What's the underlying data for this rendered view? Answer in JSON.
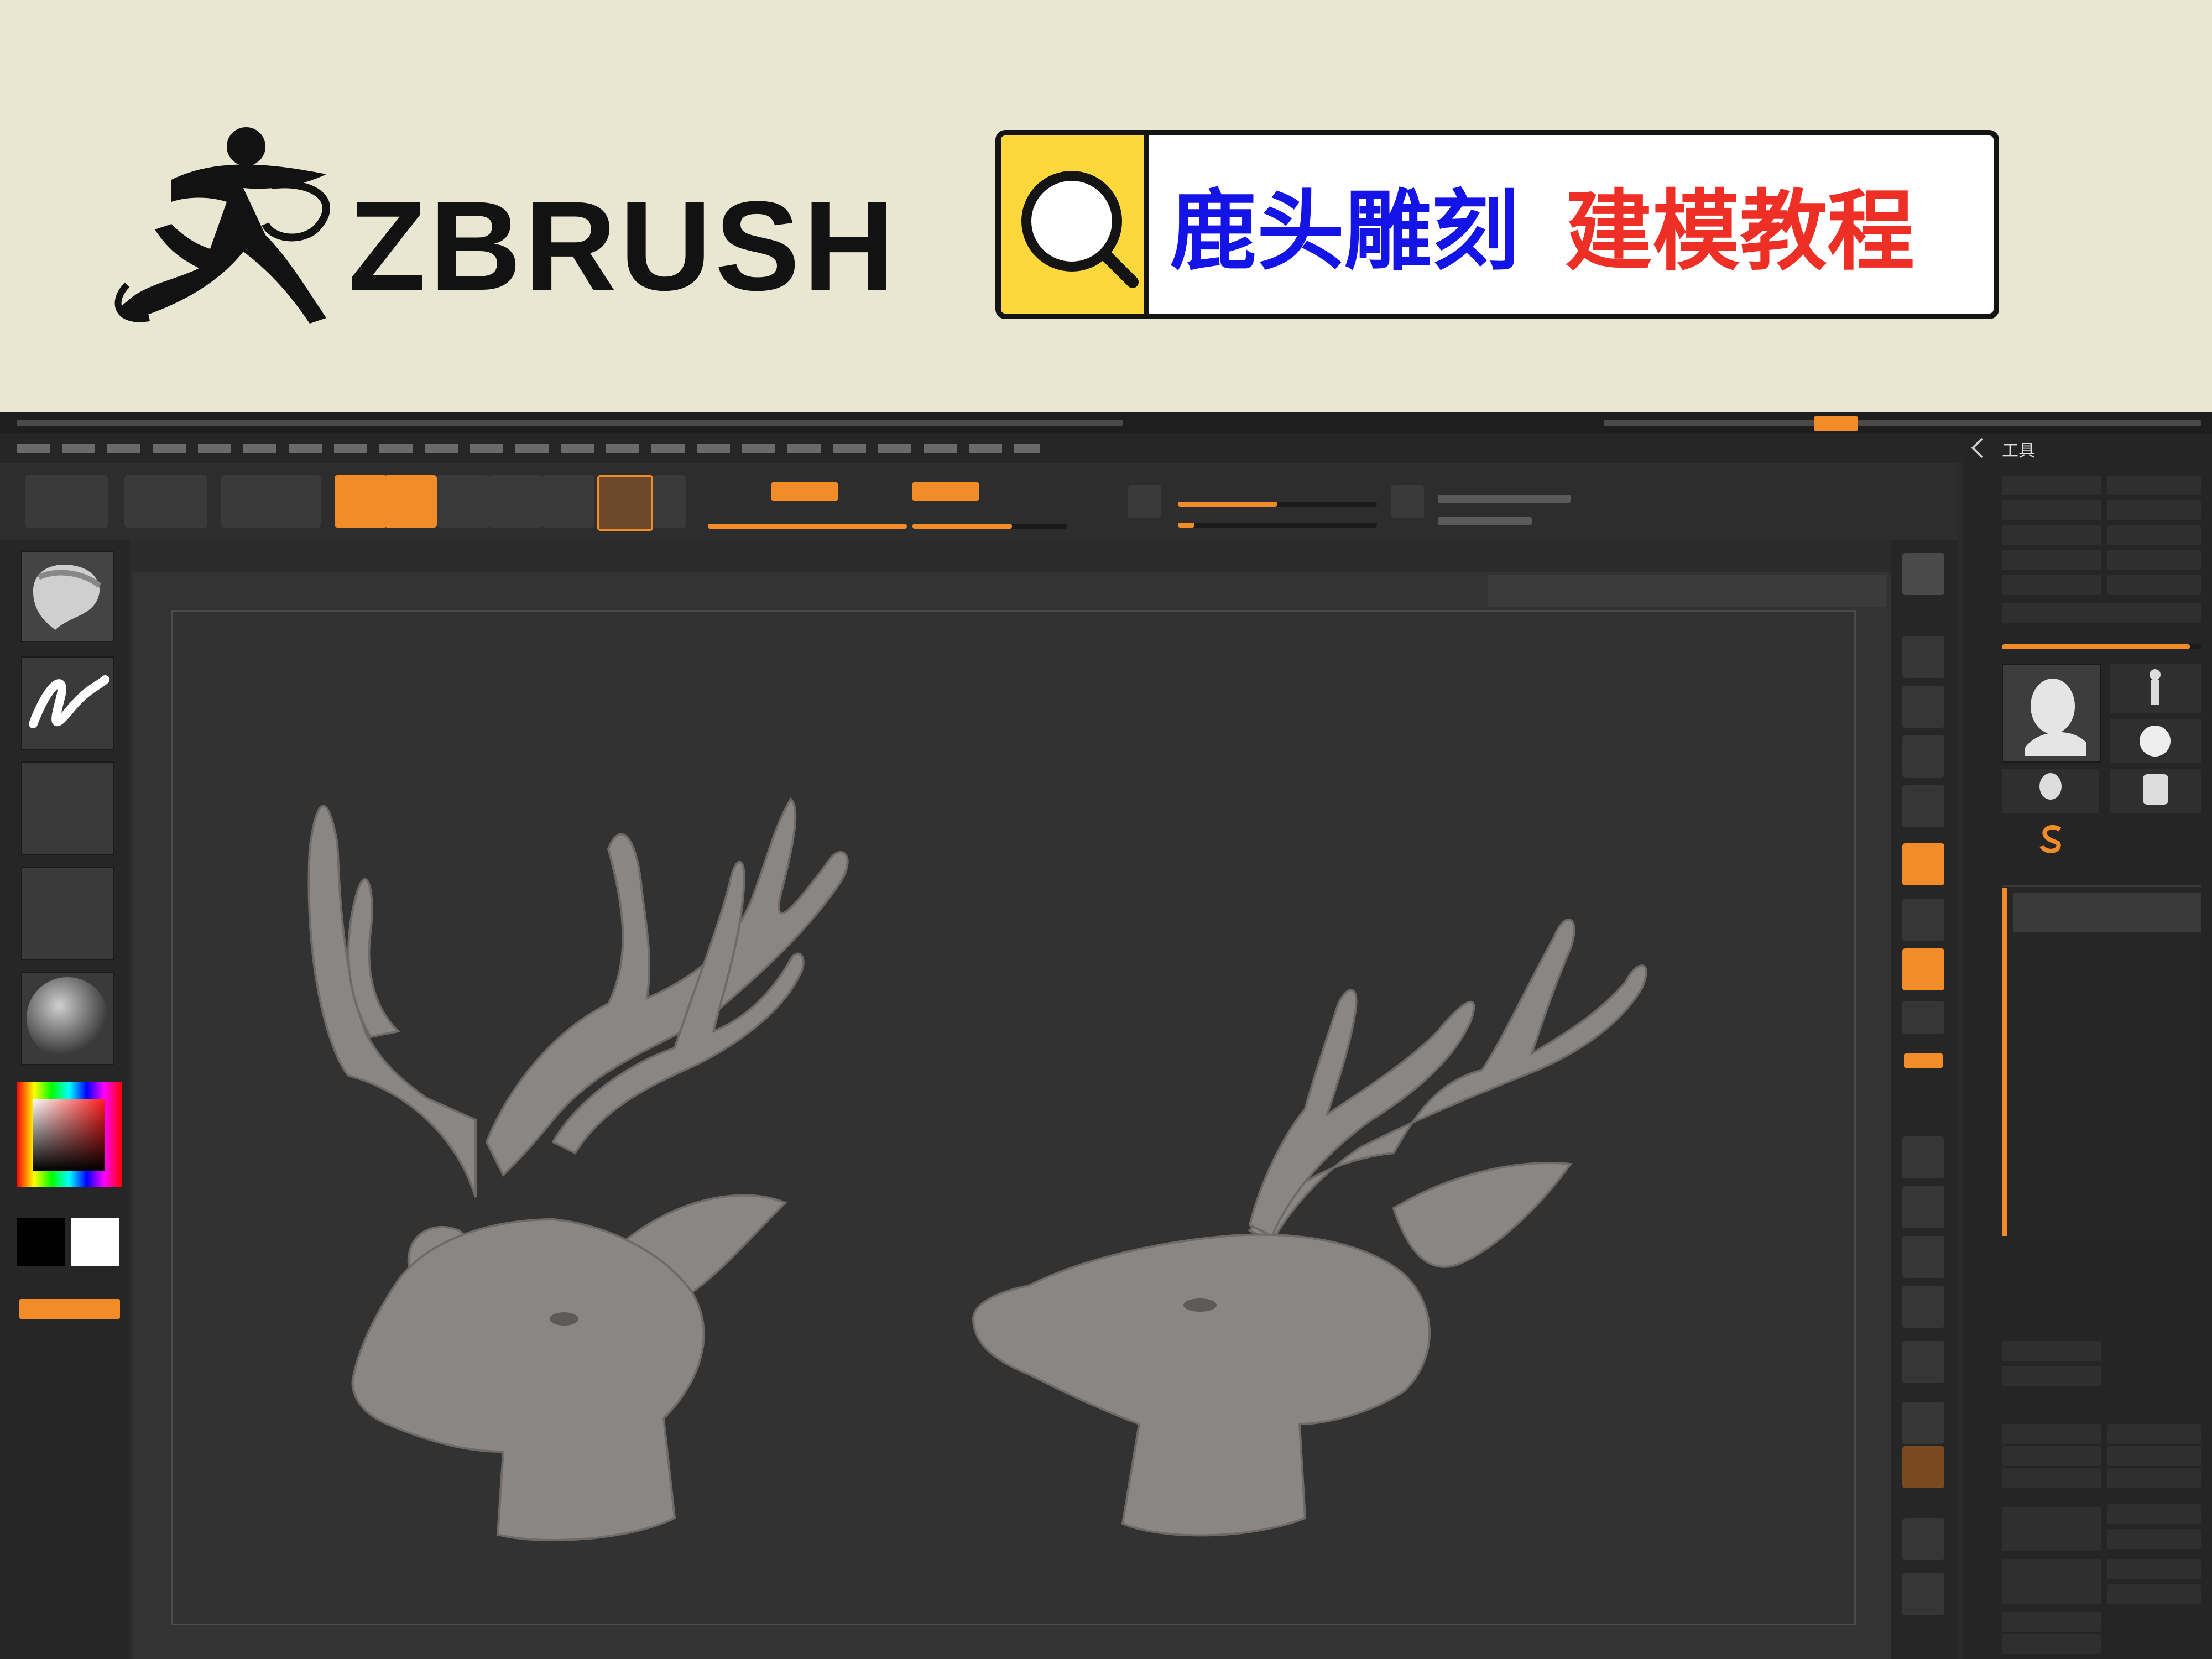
{
  "banner": {
    "logo_text": "ZBRUSH",
    "title_blue": "鹿头雕刻",
    "title_red": "建模教程",
    "colors": {
      "background": "#e9e6d2",
      "search_yellow": "#fcd83a",
      "title_blue": "#1414e6",
      "title_red": "#ee2f25",
      "logo": "#121212"
    }
  },
  "app": {
    "tray_title": "工具",
    "colors": {
      "accent": "#f28c28",
      "viewport": "#323232",
      "panel": "#262626",
      "model": "#8a8684"
    },
    "viewport_models": [
      "deer-head-three-quarter",
      "deer-head-side"
    ]
  }
}
